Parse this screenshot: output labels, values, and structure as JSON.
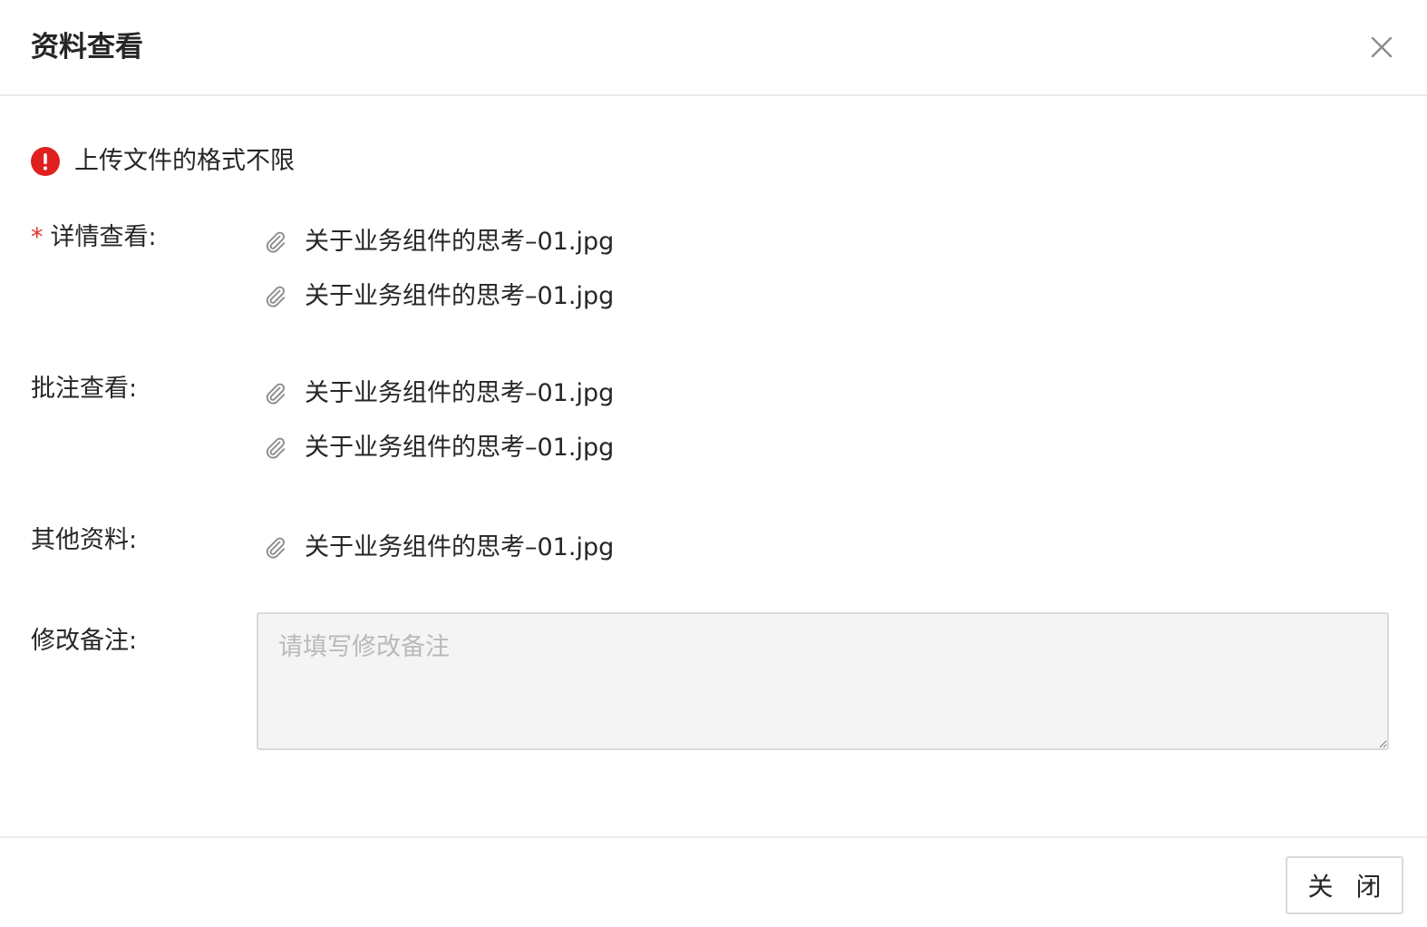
{
  "dialog": {
    "title": "资料查看",
    "close_icon": "close-icon"
  },
  "notice": {
    "icon": "error-circle-icon",
    "color": "#e0201e",
    "text": "上传文件的格式不限"
  },
  "fields": {
    "detail": {
      "required_mark": "*",
      "label": "详情查看:",
      "files": [
        "关于业务组件的思考–01.jpg",
        "关于业务组件的思考–01.jpg"
      ]
    },
    "annotation": {
      "label": "批注查看:",
      "files": [
        "关于业务组件的思考–01.jpg",
        "关于业务组件的思考–01.jpg"
      ]
    },
    "other": {
      "label": "其他资料:",
      "files": [
        "关于业务组件的思考–01.jpg"
      ]
    },
    "remark": {
      "label": "修改备注:",
      "placeholder": "请填写修改备注",
      "value": ""
    }
  },
  "footer": {
    "close_label": "关 闭"
  },
  "colors": {
    "required": "#e5332a",
    "divider": "#ebebeb",
    "input_bg": "#f4f4f4"
  }
}
